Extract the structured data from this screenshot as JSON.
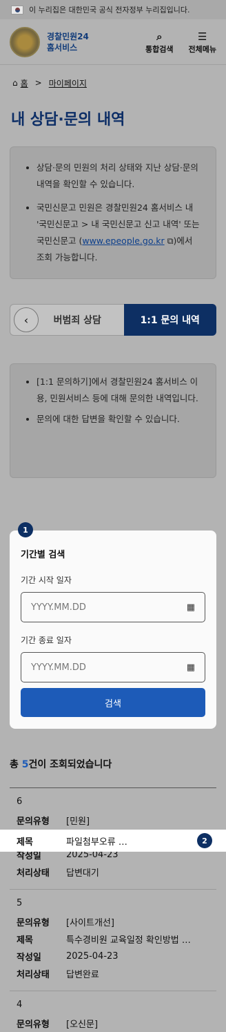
{
  "gov_banner": {
    "text": "이 누리집은 대한민국 공식 전자정부 누리집입니다."
  },
  "header": {
    "logo_line1": "경찰민원24",
    "logo_line2": "홈서비스",
    "search_label": "통합검색",
    "menu_label": "전체메뉴"
  },
  "breadcrumb": {
    "home": "홈",
    "current": "마이페이지"
  },
  "page_title": "내 상담·문의 내역",
  "info1": {
    "item1": "상담·문의 민원의 처리 상태와 지난 상담·문의 내역을 확인할 수 있습니다.",
    "item2_pre": "국민신문고 민원은 경찰민원24 홈서비스 내 '국민신문고 > 내 국민신문고 신고 내역' 또는 국민신문고 (",
    "item2_link": "www.epeople.go.kr",
    "item2_post": ")에서 조회 가능합니다."
  },
  "tabs": {
    "left": "버범죄 상담",
    "active": "1:1 문의 내역"
  },
  "info2": {
    "item1": "[1:1 문의하기]에서 경찰민원24 홈서비스 이용, 민원서비스 등에 대해 문의한 내역입니다.",
    "item2": "문의에 대한 답변을 확인할 수 있습니다."
  },
  "search_card": {
    "badge": "1",
    "title": "기간별 검색",
    "start_label": "기간 시작 일자",
    "start_placeholder": "YYYY.MM.DD",
    "end_label": "기간 종료 일자",
    "end_placeholder": "YYYY.MM.DD",
    "button": "검색"
  },
  "results": {
    "count_pre": "총 ",
    "count": "5",
    "count_post": "건이 조회되었습니다",
    "labels": {
      "type": "문의유형",
      "title": "제목",
      "date": "작성일",
      "status": "처리상태"
    },
    "highlight_badge": "2",
    "items": [
      {
        "num": "6",
        "type": "[민원]",
        "title": "파일첨부오류 …",
        "date": "2025-04-23",
        "status": "답변대기"
      },
      {
        "num": "5",
        "type": "[사이트개선]",
        "title": "특수경비원 교육일정 확인방법 …",
        "date": "2025-04-23",
        "status": "답변완료"
      },
      {
        "num": "4",
        "type": "[오신문]",
        "title": "",
        "date": "",
        "status": ""
      }
    ]
  }
}
